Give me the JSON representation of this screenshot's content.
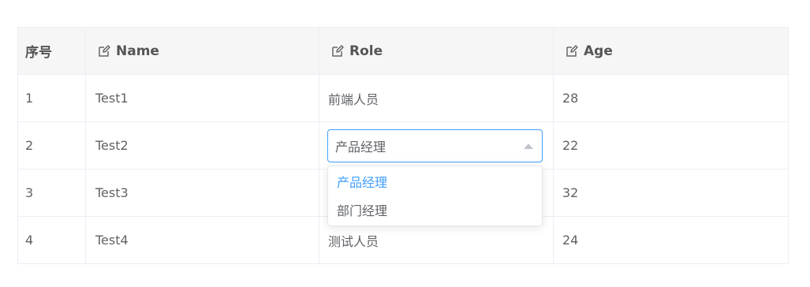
{
  "table": {
    "headers": {
      "index": "序号",
      "name": "Name",
      "role": "Role",
      "age": "Age"
    },
    "rows": [
      {
        "index": "1",
        "name": "Test1",
        "role": "前端人员",
        "age": "28"
      },
      {
        "index": "2",
        "name": "Test2",
        "role": "产品经理",
        "age": "22"
      },
      {
        "index": "3",
        "name": "Test3",
        "role": "",
        "age": "32"
      },
      {
        "index": "4",
        "name": "Test4",
        "role": "测试人员",
        "age": "24"
      }
    ]
  },
  "role_select": {
    "value": "产品经理",
    "options": [
      "产品经理",
      "部门经理"
    ],
    "selected_index": 0
  },
  "colors": {
    "accent": "#409eff",
    "text": "#606266",
    "header_bg": "#f6f6f6",
    "border": "#ebeef5"
  },
  "icons": {
    "header_edit": "edit-icon",
    "select_caret": "caret-up-icon"
  }
}
